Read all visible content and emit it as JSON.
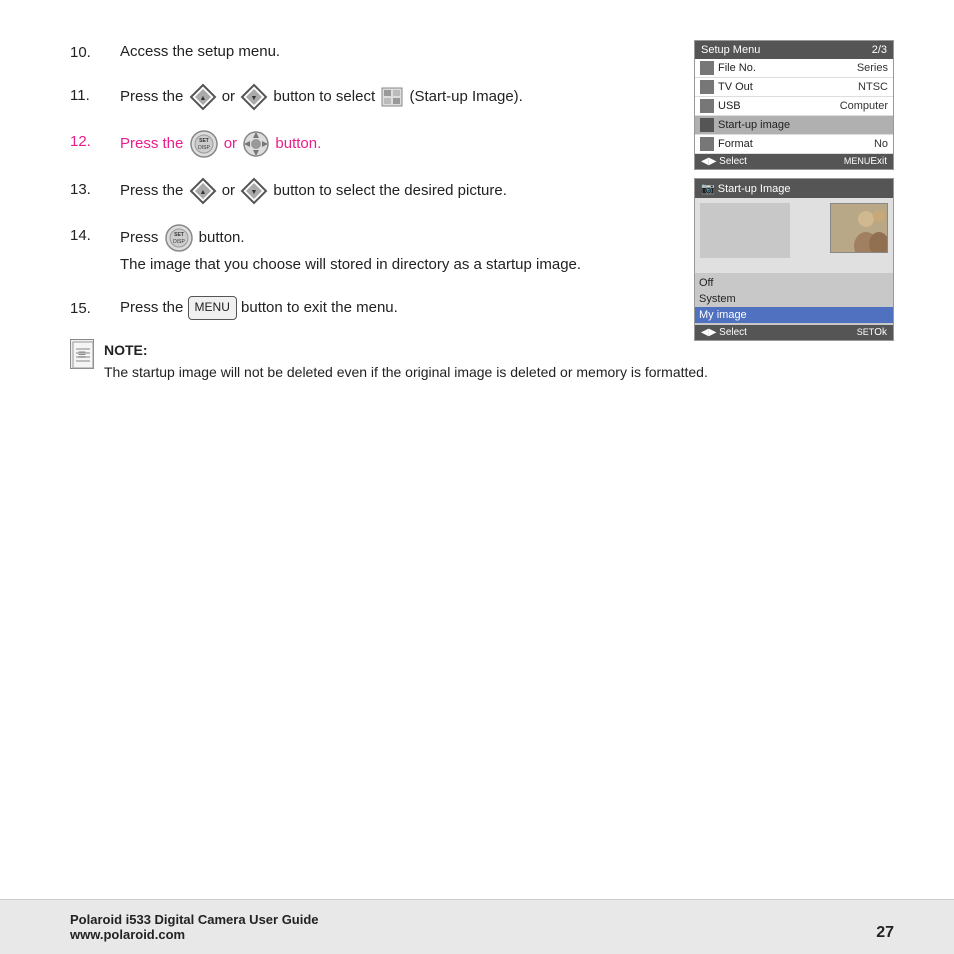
{
  "steps": [
    {
      "number": "10.",
      "text": "Access the setup menu.",
      "highlighted": false
    },
    {
      "number": "11.",
      "text_parts": [
        "Press the ",
        " or ",
        " button to select ",
        " (Start-up Image)."
      ],
      "highlighted": false,
      "has_icons": true
    },
    {
      "number": "12.",
      "text_parts": [
        "Press the ",
        " or ",
        " button."
      ],
      "highlighted": true
    },
    {
      "number": "13.",
      "text_parts": [
        "Press the ",
        " or ",
        " button to select the desired picture."
      ],
      "highlighted": false,
      "has_icons": true
    },
    {
      "number": "14.",
      "text_line1_parts": [
        "Press ",
        " button."
      ],
      "text_line2": "The image that you choose will stored in directory as a startup image.",
      "highlighted": false
    },
    {
      "number": "15.",
      "text_parts": [
        "Press the ",
        " button to exit the menu."
      ],
      "highlighted": false
    }
  ],
  "setup_menu": {
    "title": "Setup Menu",
    "page": "2/3",
    "rows": [
      {
        "label": "File No.",
        "value": "Series"
      },
      {
        "label": "TV Out",
        "value": "NTSC"
      },
      {
        "label": "USB",
        "value": "Computer"
      },
      {
        "label": "Start-up image",
        "value": "",
        "highlighted": true
      },
      {
        "label": "Format",
        "value": "No"
      }
    ],
    "footer_left": "Select",
    "footer_right": "Exit",
    "menu_label": "MENU"
  },
  "startup_panel": {
    "title": "Start-up Image",
    "options": [
      "Off",
      "System",
      "My image"
    ],
    "selected_option": "My image",
    "footer_left": "Select",
    "footer_right": "Ok",
    "menu_label": "SET"
  },
  "note": {
    "title": "NOTE:",
    "text": "The startup image will not be deleted even if the original image is deleted or memory is formatted."
  },
  "footer": {
    "line1": "Polaroid i533 Digital Camera User Guide",
    "line2": "www.polaroid.com",
    "page_number": "27"
  },
  "or_word": "or"
}
